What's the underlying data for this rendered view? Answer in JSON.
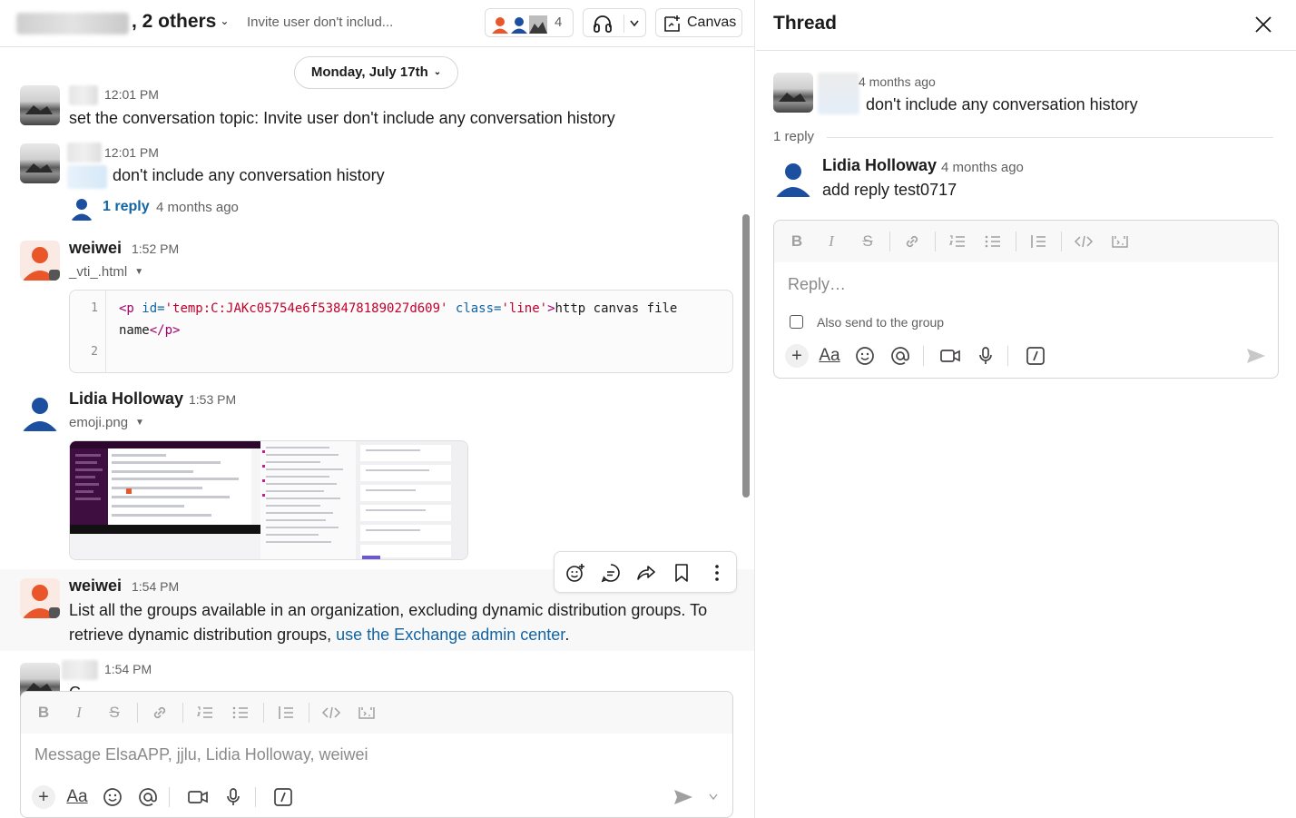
{
  "header": {
    "channel_title": ", 2 others",
    "topic": "Invite user don't includ...",
    "member_count": "4",
    "canvas_label": "Canvas"
  },
  "date_divider": "Monday, July 17th",
  "messages": [
    {
      "time": "12:01 PM",
      "text": "set the conversation topic: Invite user don't include any conversation history"
    },
    {
      "time": "12:01 PM",
      "text": "don't include any conversation history",
      "reply_label": "1 reply",
      "reply_time": "4 months ago"
    },
    {
      "author": "weiwei",
      "time": "1:52 PM",
      "file": "_vti_.html",
      "code": {
        "line_numbers": [
          "1",
          "2"
        ],
        "tag_open": "<p ",
        "attr_id": "id=",
        "val_id": "'temp:C:JAKc05754e6f538478189027d609'",
        "attr_class": " class=",
        "val_class": "'line'",
        "tag_close": ">",
        "content": "http canvas file",
        "content_wrap": "name",
        "end_tag": "</p>"
      }
    },
    {
      "author": "Lidia Holloway",
      "time": "1:53 PM",
      "file": "emoji.png"
    },
    {
      "author": "weiwei",
      "time": "1:54 PM",
      "text_line1": "List all the groups available in an organization, excluding dynamic distribution groups. To",
      "text_line2_pre": "retrieve dynamic distribution groups, ",
      "link": "use the Exchange admin center",
      "text_line2_post": "."
    },
    {
      "time": "1:54 PM",
      "text": "C..."
    }
  ],
  "composer": {
    "placeholder": "Message ElsaAPP, jjlu, Lidia Holloway, weiwei"
  },
  "thread": {
    "title": "Thread",
    "parent_time": "4 months ago",
    "parent_text": "don't include any conversation history",
    "reply_count": "1 reply",
    "reply": {
      "author": "Lidia Holloway",
      "time": "4 months ago",
      "text": "add reply test0717"
    },
    "composer_placeholder": "Reply…",
    "also_send": "Also send to the group"
  },
  "icons": {
    "format_bar": [
      "bold-icon",
      "italic-icon",
      "strikethrough-icon",
      "link-icon",
      "ordered-list-icon",
      "bulleted-list-icon",
      "blockquote-icon",
      "code-icon",
      "code-block-icon"
    ],
    "toolbar": [
      "plus-icon",
      "text-format-icon",
      "emoji-icon",
      "mention-icon",
      "video-icon",
      "microphone-icon",
      "slash-command-icon",
      "send-icon"
    ],
    "message_actions": [
      "add-reaction-icon",
      "reply-in-thread-icon",
      "forward-icon",
      "bookmark-icon",
      "more-actions-icon"
    ]
  },
  "colors": {
    "link": "#1264a3",
    "avatar_orange": "#e8562a",
    "avatar_blue": "#1d4fa0",
    "text": "#1d1c1d",
    "muted": "#616061"
  }
}
